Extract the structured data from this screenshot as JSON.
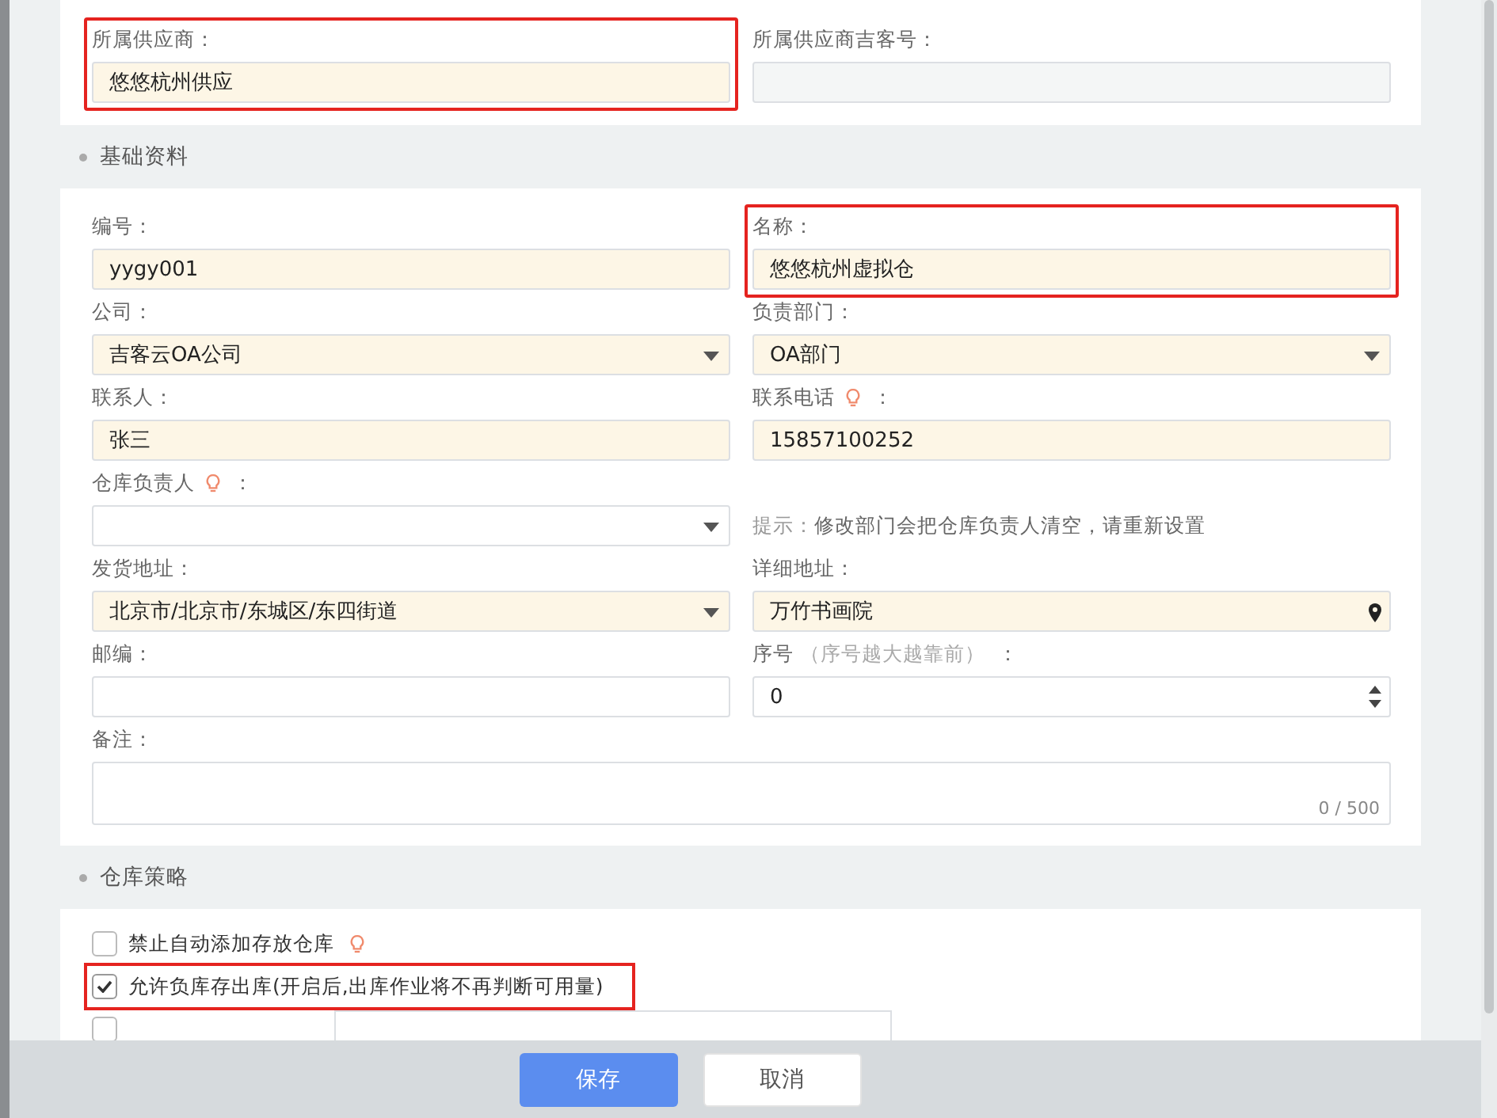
{
  "supplier_card": {
    "fields": [
      {
        "label": "所属供应商：",
        "value": "悠悠杭州供应",
        "required": true,
        "highlighted": true
      },
      {
        "label": "所属供应商吉客号：",
        "disabled": true
      }
    ]
  },
  "basic_section": {
    "title": "基础资料",
    "cells": [
      {
        "kind": "text",
        "label": "编号：",
        "value": "yygy001",
        "required": true
      },
      {
        "kind": "text",
        "label": "名称：",
        "value": "悠悠杭州虚拟仓",
        "required": true,
        "highlighted": true
      },
      {
        "kind": "select",
        "label": "公司：",
        "value": "吉客云OA公司",
        "required": true
      },
      {
        "kind": "select",
        "label": "负责部门：",
        "value": "OA部门",
        "required": true
      },
      {
        "kind": "text",
        "label": "联系人：",
        "value": "张三",
        "required": true
      },
      {
        "kind": "text",
        "label": "联系电话",
        "tip_icon": true,
        "colon": "：",
        "value": "15857100252",
        "required": true
      },
      {
        "kind": "select",
        "label": "仓库负责人",
        "tip_icon": true,
        "colon": "：",
        "required": false
      },
      {
        "kind": "hint",
        "hint_label": "提示：",
        "hint_text": "修改部门会把仓库负责人清空，请重新设置"
      },
      {
        "kind": "select",
        "label": "发货地址：",
        "value": "北京市/北京市/东城区/东四街道",
        "required": true
      },
      {
        "kind": "address",
        "label": "详细地址：",
        "value": "万竹书画院",
        "required": true
      },
      {
        "kind": "text",
        "label": "邮编：",
        "required": false
      },
      {
        "kind": "number",
        "label": "序号",
        "note": "（序号越大越靠前）",
        "colon": "：",
        "value": "0",
        "required": false
      },
      {
        "kind": "textarea",
        "label": "备注：",
        "counter": "0 / 500",
        "required": false
      }
    ]
  },
  "strategy_section": {
    "title": "仓库策略",
    "options": [
      {
        "kind": "checkbox",
        "label": "禁止自动添加存放仓库",
        "checked": false,
        "tip_icon": true
      },
      {
        "kind": "checkbox",
        "label": "允许负库存出库(开启后,出库作业将不再判断可用量)",
        "checked": true,
        "highlighted": true
      },
      {
        "kind": "checkbox_select",
        "checked": false
      }
    ]
  },
  "footer": {
    "buttons": [
      {
        "label": "保存",
        "kind": "primary"
      },
      {
        "label": "取消",
        "kind": "default"
      }
    ]
  }
}
